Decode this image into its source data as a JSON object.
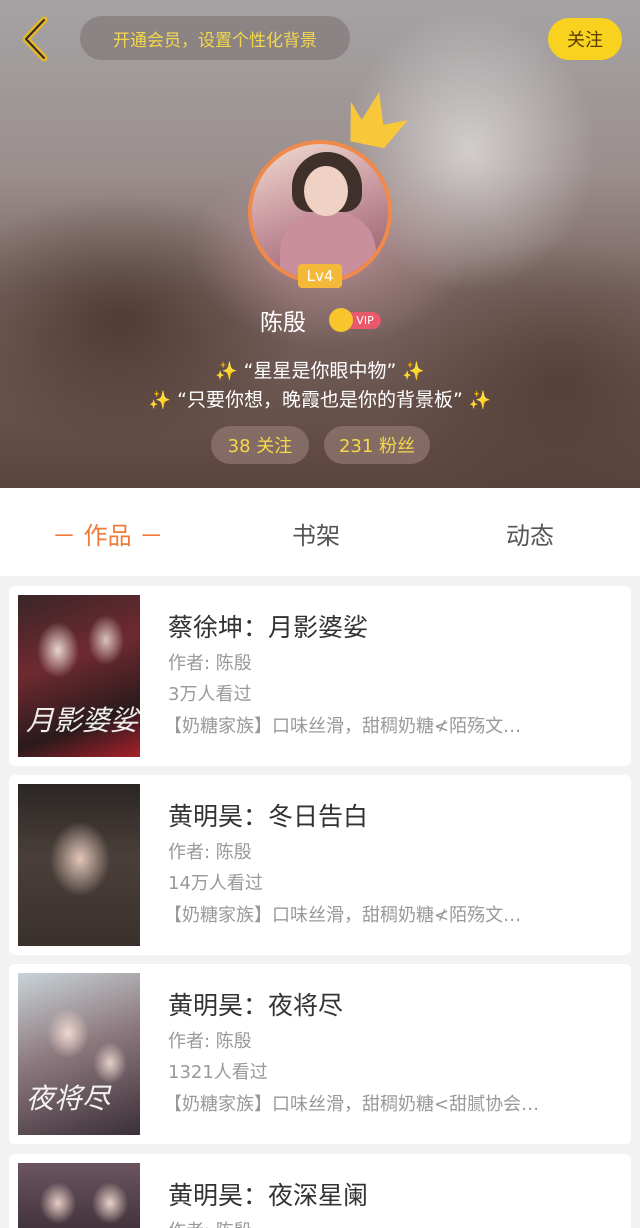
{
  "header": {
    "vip_banner": "开通会员，设置个性化背景",
    "follow_label": "关注",
    "level": "Lv4",
    "username": "陈殷",
    "vip_tag": "VIP",
    "bio_line1": "“星星是你眼中物”",
    "bio_line2": "“只要你想，晚霞也是你的背景板”",
    "sparkle": "✨",
    "following": "38 关注",
    "followers": "231 粉丝",
    "accent_color": "#f8d21e"
  },
  "tabs": [
    {
      "label": "－ 作品 －",
      "active": true
    },
    {
      "label": "书架",
      "active": false
    },
    {
      "label": "动态",
      "active": false
    }
  ],
  "works": [
    {
      "title": "蔡徐坤：月影婆娑",
      "author": "作者: 陈殷",
      "views": "3万人看过",
      "desc": "【奶糖家族】口味丝滑，甜稠奶糖≮陌殇文…",
      "cover_text": "月影婆娑"
    },
    {
      "title": "黄明昊：冬日告白",
      "author": "作者: 陈殷",
      "views": "14万人看过",
      "desc": "【奶糖家族】口味丝滑，甜稠奶糖≮陌殇文…",
      "cover_text": ""
    },
    {
      "title": "黄明昊：夜将尽",
      "author": "作者: 陈殷",
      "views": "1321人看过",
      "desc": "【奶糖家族】口味丝滑，甜稠奶糖<甜腻协会…",
      "cover_text": "夜将尽"
    },
    {
      "title": "黄明昊：夜深星阑",
      "author": "作者: 陈殷",
      "views": "",
      "desc": "",
      "cover_text": ""
    }
  ]
}
